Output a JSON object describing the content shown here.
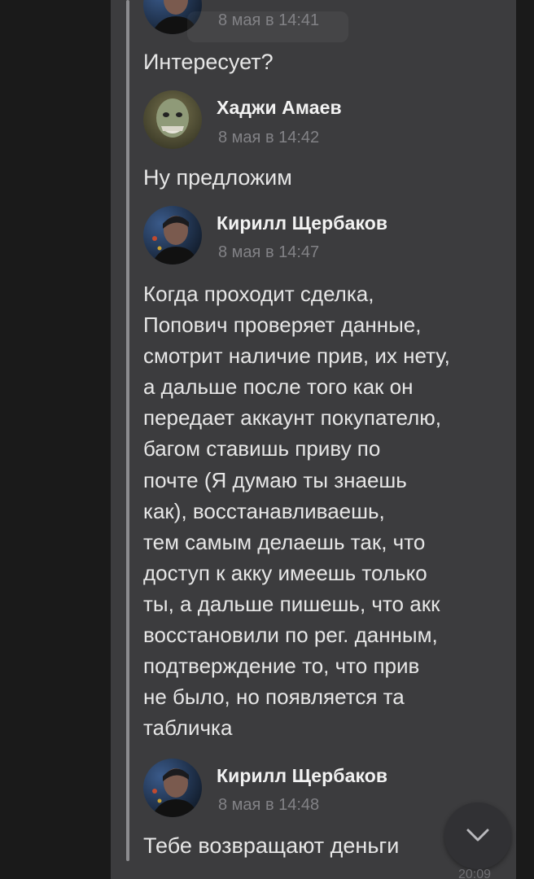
{
  "messages": [
    {
      "author": "",
      "date": "8 мая в 14:41",
      "text": "Интересует?"
    },
    {
      "author": "Хаджи Амаев",
      "date": "8 мая в 14:42",
      "text": "Ну предложим"
    },
    {
      "author": "Кирилл Щербаков",
      "date": "8 мая в 14:47",
      "lines": [
        "Когда проходит сделка,",
        "Попович проверяет данные,",
        "смотрит наличие прив, их нету,",
        "а дальше после того как он",
        "передает аккаунт покупателю,",
        "багом ставишь приву по",
        "почте (Я думаю ты знаешь",
        "как), восстанавливаешь,",
        "тем самым делаешь так, что",
        "доступ к акку имеешь только",
        "ты, а дальше пишешь, что акк",
        "восстановили по рег. данным,",
        "подтверждение то, что прив",
        "не было, но появляется та",
        "табличка"
      ]
    },
    {
      "author": "Кирилл Щербаков",
      "date": "8 мая в 14:48",
      "text": "Тебе возвращают деньги"
    }
  ],
  "bubble_time": "20:09",
  "icons": {
    "scroll_down": "chevron-down-icon",
    "avatar_kirill": "avatar-kirill",
    "avatar_khadzhi": "avatar-khadzhi"
  },
  "colors": {
    "background": "#1a1a1a",
    "bubble": "#3c3c3e",
    "quote_bar": "#8c8c8f",
    "author": "#f2f2f2",
    "date": "#828286",
    "text": "#e6e6e6"
  }
}
